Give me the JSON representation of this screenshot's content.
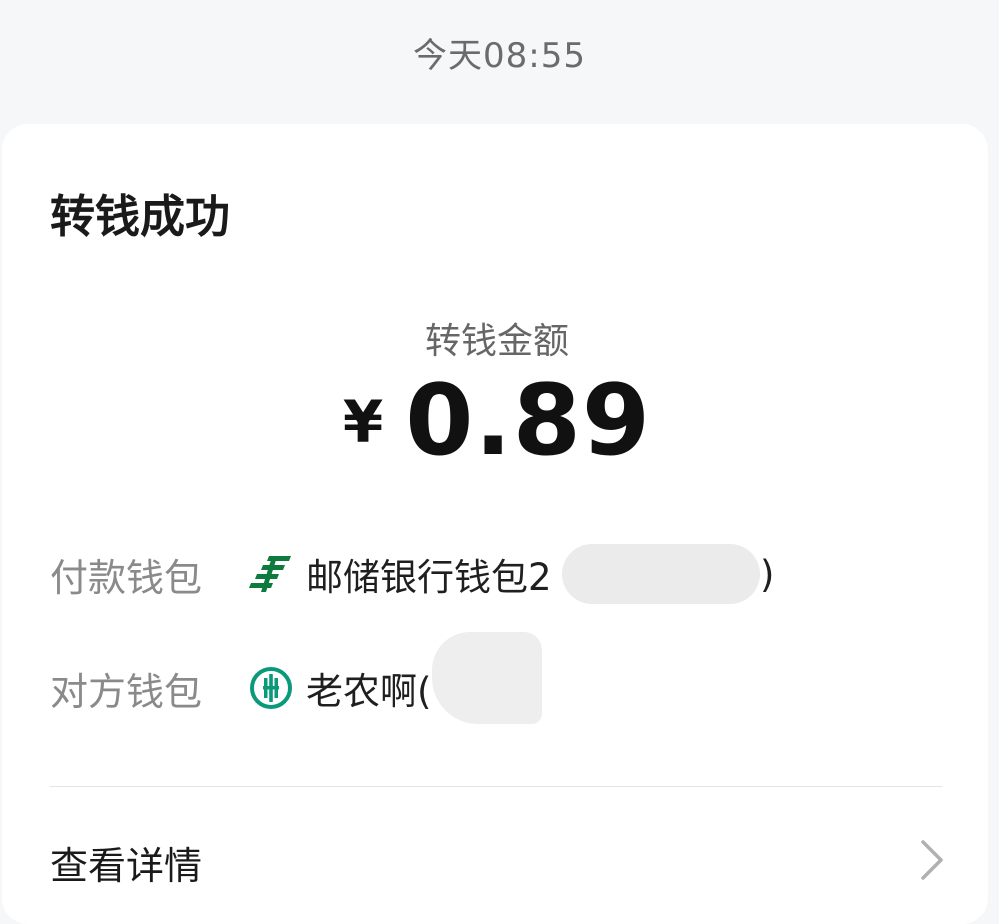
{
  "header": {
    "timestamp": "今天08:55"
  },
  "card": {
    "title": "转钱成功",
    "amount": {
      "label": "转钱金额",
      "currency_symbol": "¥",
      "value": "0.89"
    },
    "pay_wallet": {
      "label": "付款钱包",
      "icon": "postal-savings-bank-icon",
      "value": "邮储银行钱包2",
      "suffix": ")"
    },
    "payee_wallet": {
      "label": "对方钱包",
      "icon": "agricultural-bank-icon",
      "value": "老农啊("
    },
    "details": {
      "label": "查看详情",
      "icon": "chevron-right-icon"
    }
  },
  "colors": {
    "background": "#f6f7f9",
    "card": "#ffffff",
    "postal_green": "#0f7a3d",
    "abc_green": "#0a9a7a"
  }
}
